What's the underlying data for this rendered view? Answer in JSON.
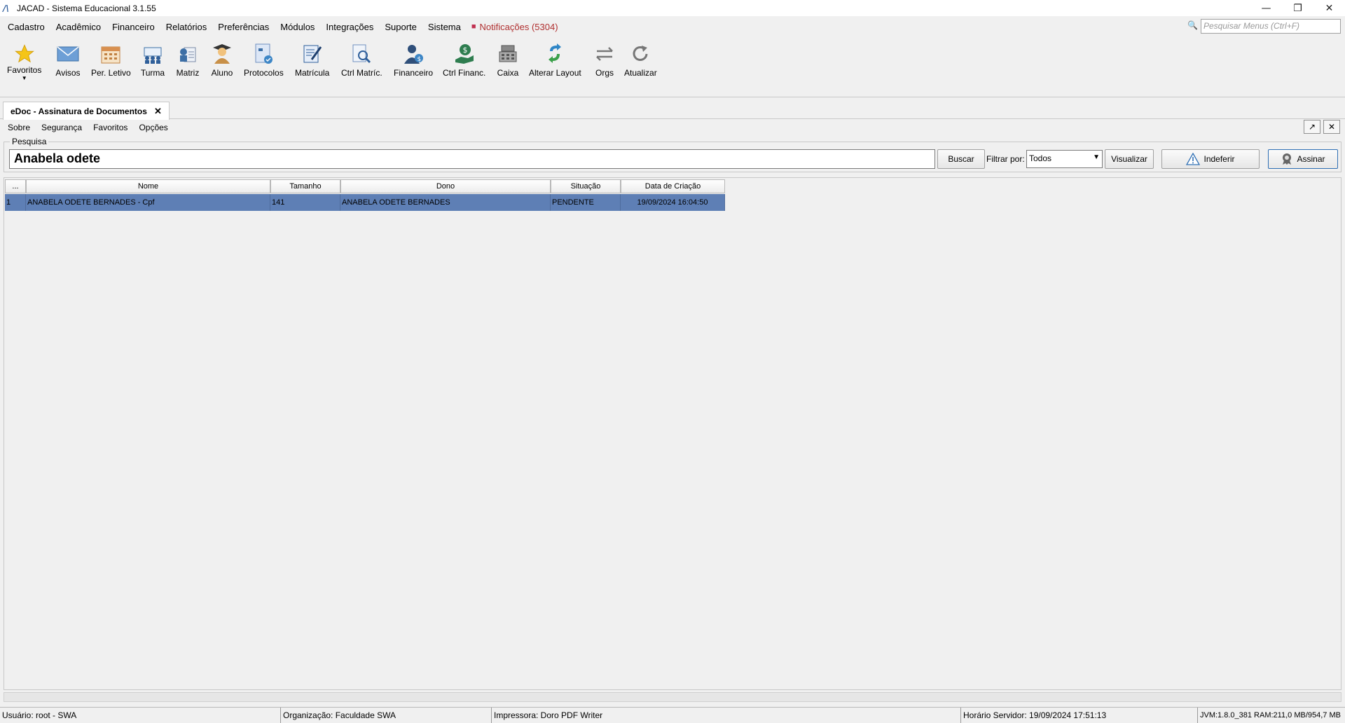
{
  "window": {
    "title": "JACAD - Sistema Educacional 3.1.55",
    "controls": [
      "—",
      "❐",
      "✕"
    ]
  },
  "menu": {
    "items": [
      "Cadastro",
      "Acadêmico",
      "Financeiro",
      "Relatórios",
      "Preferências",
      "Módulos",
      "Integrações",
      "Suporte",
      "Sistema"
    ],
    "notifications": "Notificações (5304)",
    "search_placeholder": "Pesquisar Menus (Ctrl+F)"
  },
  "toolbar": {
    "favoritos": "Favoritos",
    "avisos": "Avisos",
    "per_letivo": "Per. Letivo",
    "turma": "Turma",
    "matriz": "Matriz",
    "aluno": "Aluno",
    "protocolos": "Protocolos",
    "matricula": "Matrícula",
    "ctrl_matric": "Ctrl Matríc.",
    "financeiro": "Financeiro",
    "ctrl_financ": "Ctrl Financ.",
    "caixa": "Caixa",
    "alterar_layout": "Alterar Layout",
    "orgs": "Orgs",
    "atualizar": "Atualizar"
  },
  "tab": {
    "label": "eDoc - Assinatura de Documentos"
  },
  "submenu": {
    "items": [
      "Sobre",
      "Segurança",
      "Favoritos",
      "Opções"
    ]
  },
  "search": {
    "group_label": "Pesquisa",
    "value": "Anabela odete",
    "buscar": "Buscar",
    "filter_label": "Filtrar por:",
    "filter_value": "Todos",
    "visualizar": "Visualizar",
    "indeferir": "Indeferir",
    "assinar": "Assinar"
  },
  "table": {
    "columns": [
      "...",
      "Nome",
      "Tamanho",
      "Dono",
      "Situação",
      "Data de Criação"
    ],
    "rows": [
      {
        "index": "1",
        "nome": "ANABELA ODETE BERNADES - Cpf",
        "tamanho": "141",
        "dono": "ANABELA ODETE BERNADES",
        "situacao": "PENDENTE",
        "data": "19/09/2024 16:04:50"
      }
    ]
  },
  "status": {
    "usuario": "Usuário: root - SWA",
    "organizacao": "Organização: Faculdade SWA",
    "impressora": "Impressora: Doro PDF Writer",
    "horario": "Horário Servidor: 19/09/2024 17:51:13",
    "jvm": "JVM:1.8.0_381  RAM:211,0 MB/954,7 MB"
  },
  "colors": {
    "selection": "#5e7fb5",
    "notification": "#b03030"
  }
}
